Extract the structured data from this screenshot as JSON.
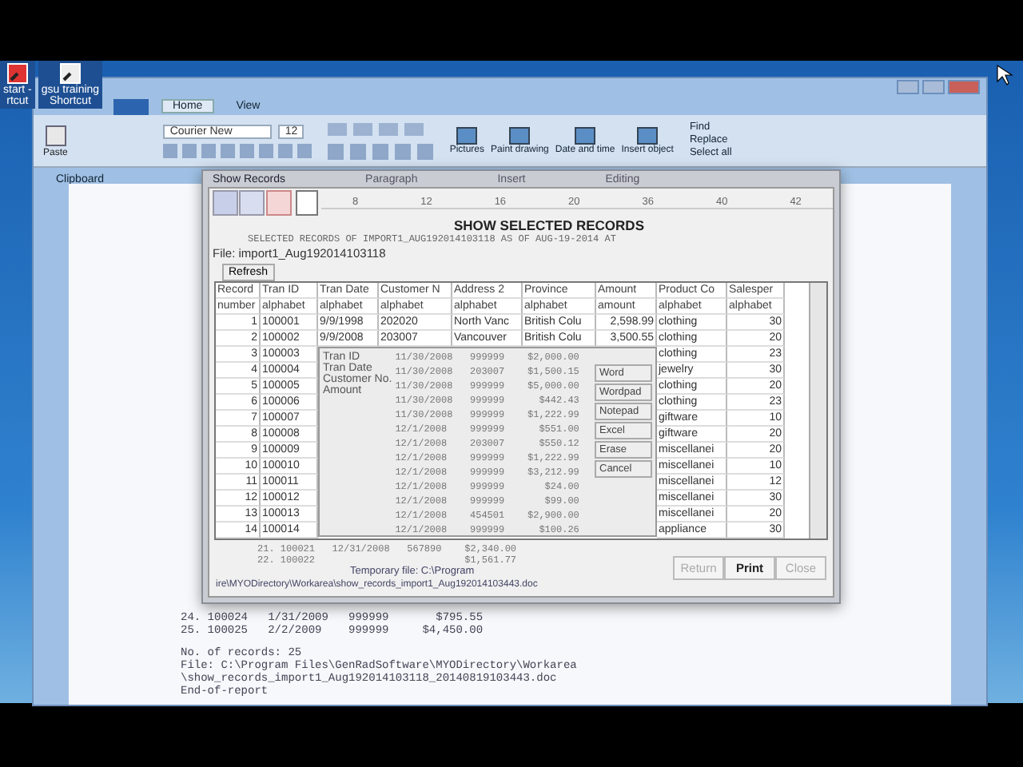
{
  "desktop": {
    "icons": [
      {
        "lines": [
          "start -",
          "rtcut"
        ]
      },
      {
        "lines": [
          "gsu training",
          "Shortcut"
        ]
      }
    ]
  },
  "wordpad": {
    "tabs": [
      {
        "label": "Home",
        "selected": true
      },
      {
        "label": "View",
        "selected": false
      }
    ],
    "font_name": "Courier New",
    "font_size": "12",
    "paste": "Paste",
    "insert_buttons": [
      "Pictures",
      "Paint drawing",
      "Date and time",
      "Insert object"
    ],
    "editing_buttons": [
      "Find",
      "Replace",
      "Select all"
    ],
    "clipboard_label": "Clipboard",
    "document_lines": [
      "24. 100024   1/31/2009   999999       $795.55",
      "25. 100025   2/2/2009    999999     $4,450.00",
      "No. of records: 25",
      "File: C:\\Program Files\\GenRadSoftware\\MYODirectory\\Workarea",
      "\\show_records_import1_Aug192014103118_20140819103443.doc",
      "End-of-report"
    ]
  },
  "dialog": {
    "title": "Show Records",
    "ghost_labels": [
      "Paragraph",
      "Insert",
      "Editing"
    ],
    "ruler": [
      "8",
      "12",
      "16",
      "20",
      "36",
      "40",
      "42"
    ],
    "heading": "SHOW SELECTED RECORDS",
    "subtitle": "SELECTED RECORDS OF IMPORT1_AUG192014103118 AS OF AUG-19-2014 AT",
    "file": "File: import1_Aug192014103118",
    "refresh": "Refresh",
    "table": {
      "columns": [
        {
          "label": "Record",
          "type": "number"
        },
        {
          "label": "Tran ID",
          "type": "alphabet"
        },
        {
          "label": "Tran Date",
          "type": "alphabet"
        },
        {
          "label": "Customer N",
          "type": "alphabet"
        },
        {
          "label": "Address 2",
          "type": "alphabet"
        },
        {
          "label": "Province",
          "type": "alphabet"
        },
        {
          "label": "Amount",
          "type": "amount"
        },
        {
          "label": "Product Co",
          "type": "alphabet"
        },
        {
          "label": "Salesper",
          "type": "alphabet"
        }
      ],
      "rows": [
        {
          "cells": [
            "1",
            "100001",
            "9/9/1998",
            "202020",
            "North Vanc",
            "British Colu",
            "2,598.99",
            "clothing",
            "30"
          ]
        },
        {
          "cells": [
            "2",
            "100002",
            "9/9/2008",
            "203007",
            "Vancouver",
            "British Colu",
            "3,500.55",
            "clothing",
            "20"
          ]
        },
        {
          "cells": [
            "3",
            "100003",
            "",
            "",
            "",
            "",
            "",
            "clothing",
            "23"
          ]
        },
        {
          "cells": [
            "4",
            "100004",
            "",
            "",
            "",
            "",
            "",
            "jewelry",
            "30"
          ]
        },
        {
          "cells": [
            "5",
            "100005",
            "",
            "",
            "",
            "",
            "",
            "clothing",
            "20"
          ]
        },
        {
          "cells": [
            "6",
            "100006",
            "",
            "",
            "",
            "",
            "",
            "clothing",
            "23"
          ]
        },
        {
          "cells": [
            "7",
            "100007",
            "",
            "",
            "",
            "",
            "",
            "giftware",
            "10"
          ]
        },
        {
          "cells": [
            "8",
            "100008",
            "",
            "",
            "",
            "",
            "",
            "giftware",
            "20"
          ]
        },
        {
          "cells": [
            "9",
            "100009",
            "",
            "",
            "",
            "",
            "",
            "miscellanei",
            "20"
          ]
        },
        {
          "cells": [
            "10",
            "100010",
            "",
            "",
            "",
            "",
            "",
            "miscellanei",
            "10"
          ]
        },
        {
          "cells": [
            "11",
            "100011",
            "",
            "",
            "",
            "",
            "",
            "miscellanei",
            "12"
          ]
        },
        {
          "cells": [
            "12",
            "100012",
            "",
            "",
            "",
            "",
            "",
            "miscellanei",
            "30"
          ]
        },
        {
          "cells": [
            "13",
            "100013",
            "",
            "",
            "",
            "",
            "",
            "miscellanei",
            "20"
          ]
        },
        {
          "cells": [
            "14",
            "100014",
            "",
            "",
            "",
            "",
            "",
            "appliance",
            "30"
          ]
        }
      ]
    },
    "popup": {
      "labels": [
        "Tran ID",
        "Tran Date",
        "Customer No.",
        "Amount"
      ],
      "lines": [
        "11/30/2008   999999    $2,000.00",
        "11/30/2008   203007    $1,500.15",
        "11/30/2008   999999    $5,000.00",
        "11/30/2008   999999      $442.43",
        "11/30/2008   999999    $1,222.99",
        "12/1/2008    999999      $551.00",
        "12/1/2008    203007      $550.12",
        "12/1/2008    999999    $1,222.99",
        "12/1/2008    999999    $3,212.99",
        "12/1/2008    999999       $24.00",
        "12/1/2008    999999       $99.00",
        "12/1/2008    454501    $2,900.00",
        "12/1/2008    999999      $100.26"
      ],
      "menu": [
        "Word",
        "Wordpad",
        "Notepad",
        "Excel",
        "Erase",
        "Cancel"
      ]
    },
    "report_lines": [
      "21. 100021   12/31/2008   567890    $2,340.00",
      "22. 100022                          $1,561.77"
    ],
    "temp_file": "Temporary file: C:\\Program",
    "temp_path": "ire\\MYODirectory\\Workarea\\show_records_import1_Aug192014103443.doc",
    "buttons": [
      {
        "label": "Return",
        "disabled": true
      },
      {
        "label": "Print",
        "disabled": false
      },
      {
        "label": "Close",
        "disabled": true
      }
    ]
  }
}
